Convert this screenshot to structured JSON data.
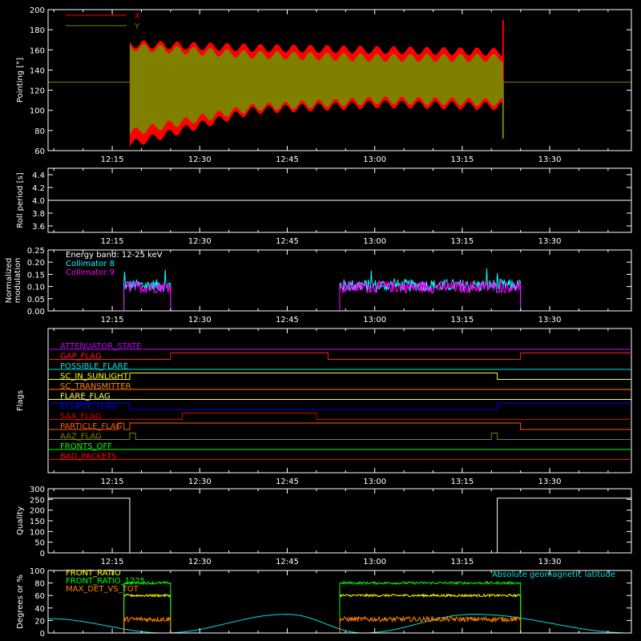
{
  "time_axis": {
    "ticks": [
      "12:15",
      "12:30",
      "12:45",
      "13:00",
      "13:15",
      "13:30"
    ],
    "tick_minutes": [
      735,
      750,
      765,
      780,
      795,
      810
    ],
    "range": [
      "12:04",
      "13:44"
    ],
    "range_minutes": [
      724,
      824
    ]
  },
  "chart_data": [
    {
      "type": "area",
      "ylabel": "Pointing [°]",
      "ylim": [
        60,
        200
      ],
      "yticks": [
        60,
        80,
        100,
        120,
        140,
        160,
        180,
        200
      ],
      "legend": {
        "placement": "top-left"
      },
      "series": [
        {
          "name": "X",
          "color": "#ff0000",
          "baseline": 128,
          "active": [
            "12:18",
            "13:22"
          ],
          "lower": [
            66,
            100,
            106,
            104
          ],
          "upper": [
            166,
            162,
            160,
            158
          ],
          "end_spike": 190
        },
        {
          "name": "Y",
          "color": "#808000",
          "baseline": 128,
          "active": [
            "12:18",
            "13:22"
          ],
          "lower": [
            78,
            103,
            110,
            108
          ],
          "upper": [
            163,
            155,
            152,
            152
          ],
          "end_spike": 72
        }
      ]
    },
    {
      "type": "line",
      "ylabel": "Roll period [s]",
      "ylim": [
        3.5,
        4.5
      ],
      "yticks": [
        "3.6",
        "3.8",
        "4.0",
        "4.2",
        "4.4"
      ],
      "series": [
        {
          "color": "#ffffff",
          "x": [
            "12:04",
            "13:44"
          ],
          "y": [
            4.0,
            4.0
          ]
        }
      ]
    },
    {
      "type": "line",
      "ylabel": "Normalized modulation",
      "ylim": [
        0,
        0.25
      ],
      "yticks": [
        "0.00",
        "0.05",
        "0.10",
        "0.15",
        "0.20",
        "0.25"
      ],
      "legend": {
        "placement": "top-left",
        "entries": [
          "Energy band: 12-25 keV",
          "Collimator 8",
          "Collimator 9"
        ],
        "colors": [
          "#ffffff",
          "#00ffff",
          "#ff00ff"
        ]
      },
      "series": [
        {
          "name": "Collimator 8",
          "color": "#00ffff",
          "segments": [
            [
              "12:17",
              "12:25"
            ],
            [
              "12:54",
              "13:25"
            ]
          ],
          "mean": 0.1
        },
        {
          "name": "Collimator 9",
          "color": "#ff00ff",
          "segments": [
            [
              "12:17",
              "12:25"
            ],
            [
              "12:54",
              "13:25"
            ]
          ],
          "mean": 0.1
        }
      ]
    },
    {
      "type": "line",
      "ylabel": "Flags",
      "series": [
        {
          "name": "ATTENUATOR_STATE",
          "color": "#c000ff",
          "steps": [
            [
              "12:04",
              0
            ]
          ]
        },
        {
          "name": "GAP_FLAG",
          "color": "#ff2020",
          "steps": [
            [
              "12:04",
              0
            ],
            [
              "12:25",
              1
            ],
            [
              "12:52",
              0
            ],
            [
              "13:25",
              1
            ]
          ]
        },
        {
          "name": "POSSIBLE_FLARE",
          "color": "#00e0e0",
          "steps": [
            [
              "12:04",
              0
            ]
          ]
        },
        {
          "name": "SC_IN_SUNLIGHT",
          "color": "#ffff00",
          "steps": [
            [
              "12:04",
              0
            ],
            [
              "12:18",
              1
            ],
            [
              "13:21",
              0
            ]
          ]
        },
        {
          "name": "SC_TRANSMITTER",
          "color": "#ff8000",
          "steps": [
            [
              "12:04",
              0
            ]
          ]
        },
        {
          "name": "FLARE_FLAG",
          "color": "#ffff60",
          "steps": [
            [
              "12:04",
              0
            ]
          ]
        },
        {
          "name": "ECLIPSE_FLAG",
          "color": "#0000ff",
          "steps": [
            [
              "12:04",
              1
            ],
            [
              "12:18",
              0
            ],
            [
              "13:21",
              1
            ]
          ]
        },
        {
          "name": "SAA_FLAG",
          "color": "#e00000",
          "steps": [
            [
              "12:04",
              0
            ],
            [
              "12:27",
              1
            ],
            [
              "12:50",
              0
            ]
          ]
        },
        {
          "name": "PARTICLE_FLAG",
          "color": "#ff6000",
          "steps": [
            [
              "12:04",
              0
            ],
            [
              "12:16",
              1
            ],
            [
              "12:17",
              0
            ],
            [
              "12:18",
              1
            ],
            [
              "13:25",
              0
            ]
          ]
        },
        {
          "name": "AAZ_FLAG",
          "color": "#808000",
          "steps": [
            [
              "12:04",
              0
            ],
            [
              "12:18",
              1
            ],
            [
              "12:19",
              0
            ],
            [
              "13:20",
              1
            ],
            [
              "13:21",
              0
            ]
          ]
        },
        {
          "name": "FRONTS_OFF",
          "color": "#00ff00",
          "steps": [
            [
              "12:04",
              0
            ]
          ]
        },
        {
          "name": "BAD_PACKETS",
          "color": "#ff0000",
          "steps": [
            [
              "12:04",
              0
            ]
          ]
        }
      ]
    },
    {
      "type": "line",
      "ylabel": "Quality",
      "ylim": [
        0,
        300
      ],
      "yticks": [
        0,
        50,
        100,
        150,
        200,
        250,
        300
      ],
      "series": [
        {
          "color": "#ffffff",
          "steps": [
            [
              "12:04",
              256
            ],
            [
              "12:18",
              0
            ],
            [
              "13:21",
              256
            ],
            [
              "13:44",
              256
            ]
          ]
        }
      ]
    },
    {
      "type": "line",
      "ylabel": "Degrees or %",
      "ylim": [
        0,
        100
      ],
      "yticks": [
        0,
        20,
        40,
        60,
        80,
        100
      ],
      "legend": {
        "placement": "top-left",
        "right_label": "Absolute geomagnetic latitude"
      },
      "series": [
        {
          "name": "FRONT_RATIO",
          "color": "#ffff00",
          "segments": [
            [
              "12:17",
              "12:25"
            ],
            [
              "12:54",
              "13:25"
            ]
          ],
          "mean": 60
        },
        {
          "name": "FRONT_RATIO_1225",
          "color": "#00ff00",
          "segments": [
            [
              "12:17",
              "12:25"
            ],
            [
              "12:54",
              "13:25"
            ]
          ],
          "mean": 80
        },
        {
          "name": "MAX_DET_VS_TOT",
          "color": "#ff8000",
          "segments": [
            [
              "12:17",
              "12:25"
            ],
            [
              "12:54",
              "13:25"
            ]
          ],
          "mean": 22
        },
        {
          "name": "Absolute geomagnetic latitude",
          "color": "#00dddd",
          "x": [
            "12:04",
            "12:24",
            "12:45",
            "12:58",
            "13:17",
            "13:44"
          ],
          "y": [
            23,
            0,
            30,
            0,
            30,
            0
          ]
        }
      ]
    }
  ]
}
